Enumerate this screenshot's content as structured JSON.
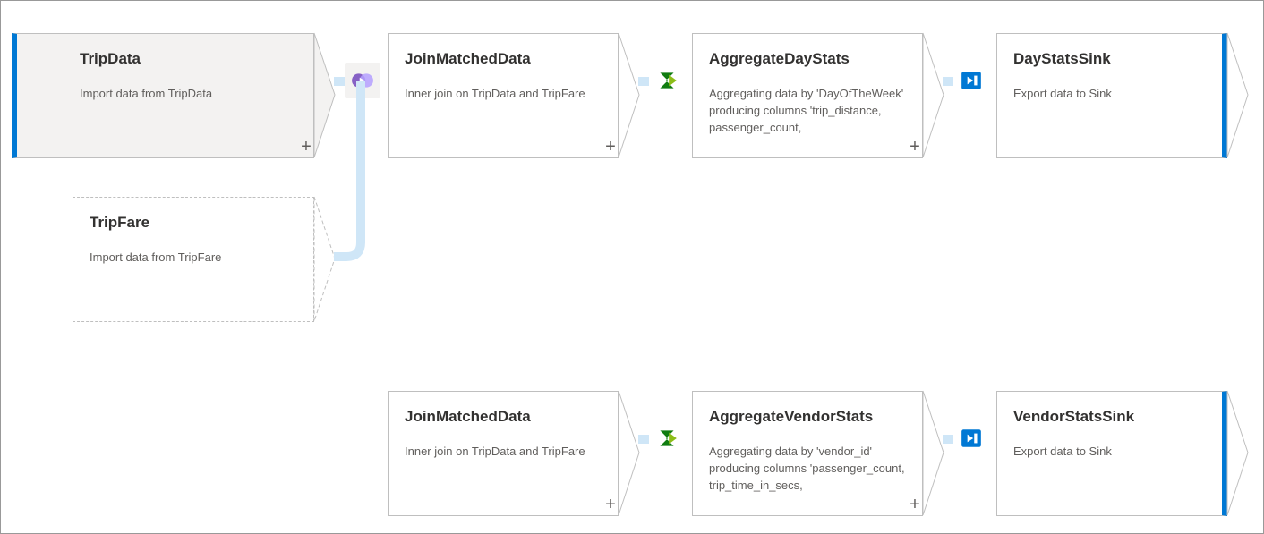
{
  "nodes": {
    "tripData": {
      "title": "TripData",
      "desc": "Import data from TripData"
    },
    "tripFare": {
      "title": "TripFare",
      "desc": "Import data from TripFare"
    },
    "joinMatched1": {
      "title": "JoinMatchedData",
      "desc": "Inner join on TripData and TripFare"
    },
    "aggDay": {
      "title": "AggregateDayStats",
      "desc": "Aggregating data by 'DayOfTheWeek' producing columns 'trip_distance, passenger_count,"
    },
    "daySink": {
      "title": "DayStatsSink",
      "desc": "Export data to Sink"
    },
    "joinMatched2": {
      "title": "JoinMatchedData",
      "desc": "Inner join on TripData and TripFare"
    },
    "aggVendor": {
      "title": "AggregateVendorStats",
      "desc": "Aggregating data by 'vendor_id' producing columns 'passenger_count, trip_time_in_secs,"
    },
    "vendorSink": {
      "title": "VendorStatsSink",
      "desc": "Export data to Sink"
    }
  },
  "plus": "+",
  "colors": {
    "accent": "#0078d4",
    "flow": "#cfe6f7"
  }
}
